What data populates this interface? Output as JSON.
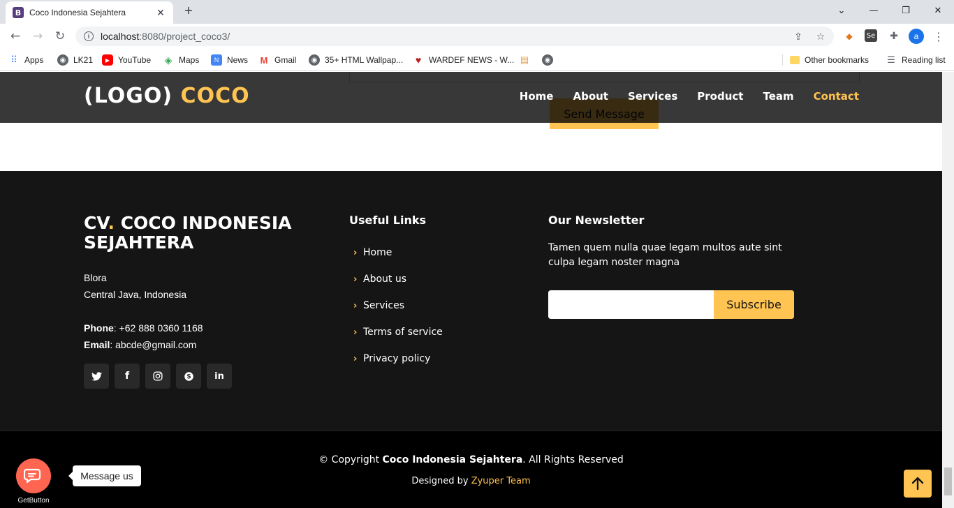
{
  "browser": {
    "tab_title": "Coco Indonesia Sejahtera",
    "tab_favicon": "B",
    "url_host": "localhost",
    "url_rest": ":8080/project_coco3/",
    "profile_initial": "a",
    "bookmarks": [
      {
        "label": "Apps",
        "icon": "apps-grid-icon"
      },
      {
        "label": "LK21",
        "icon": "globe-icon"
      },
      {
        "label": "YouTube",
        "icon": "youtube-icon"
      },
      {
        "label": "Maps",
        "icon": "maps-icon"
      },
      {
        "label": "News",
        "icon": "news-icon"
      },
      {
        "label": "Gmail",
        "icon": "gmail-icon"
      },
      {
        "label": "35+ HTML Wallpap...",
        "icon": "globe-icon"
      },
      {
        "label": "WARDEF NEWS - W...",
        "icon": "wardef-icon"
      }
    ],
    "other_bookmarks": "Other bookmarks",
    "reading_list": "Reading list"
  },
  "header": {
    "logo_main": "(LOGO) ",
    "logo_accent": "COCO",
    "nav": [
      "Home",
      "About",
      "Services",
      "Product",
      "Team",
      "Contact"
    ],
    "active_nav": "Contact"
  },
  "underlay": {
    "send_message": "Send Message"
  },
  "footer": {
    "company_name": "CV",
    "company_dot": ".",
    "company_rest": " COCO INDONESIA SEJAHTERA",
    "address_line1": "Blora",
    "address_line2": "Central Java, Indonesia",
    "phone_label": "Phone",
    "phone_value": ": +62 888 0360 1168",
    "email_label": "Email",
    "email_value": ": abcde@gmail.com",
    "socials": [
      "twitter-icon",
      "facebook-icon",
      "instagram-icon",
      "skype-icon",
      "linkedin-icon"
    ],
    "useful_links_title": "Useful Links",
    "useful_links": [
      "Home",
      "About us",
      "Services",
      "Terms of service",
      "Privacy policy"
    ],
    "newsletter_title": "Our Newsletter",
    "newsletter_text": "Tamen quem nulla quae legam multos aute sint culpa legam noster magna",
    "newsletter_input_value": "",
    "subscribe_label": "Subscribe",
    "copyright_prefix": "© Copyright ",
    "copyright_brand": "Coco Indonesia Sejahtera",
    "copyright_suffix": ". All Rights Reserved",
    "designed_by": "Designed by ",
    "designer": "Zyuper Team"
  },
  "widgets": {
    "getbutton_label": "GetButton",
    "message_us": "Message us"
  },
  "colors": {
    "accent": "#ffc451",
    "footer_bg": "#151515",
    "bottom_bg": "#000000",
    "getbutton": "#ff6550"
  }
}
